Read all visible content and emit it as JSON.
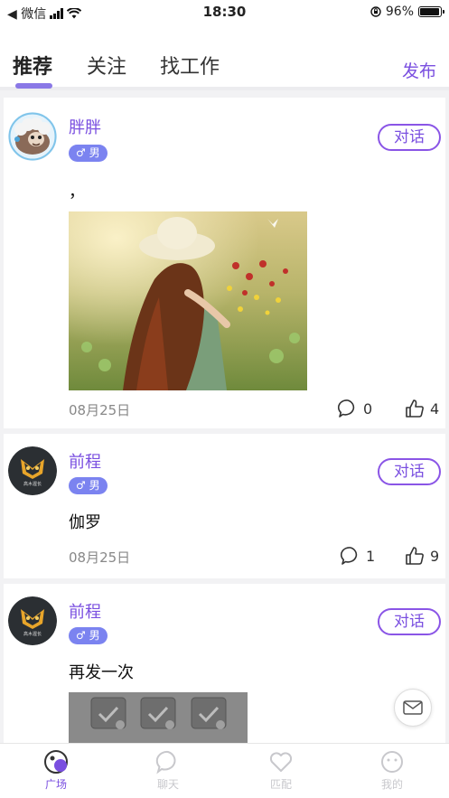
{
  "status_bar": {
    "carrier": "◀ 微信",
    "time": "18:30",
    "battery_text": "96%",
    "battery_level": 0.96
  },
  "top_tabs": [
    {
      "label": "推荐",
      "active": true
    },
    {
      "label": "关注",
      "active": false
    },
    {
      "label": "找工作",
      "active": false
    }
  ],
  "publish_label": "发布",
  "chat_label": "对话",
  "posts": [
    {
      "username": "胖胖",
      "gender": "♂ 男",
      "text": "，",
      "has_photo": true,
      "date": "08月25日",
      "comments": "0",
      "likes": "4"
    },
    {
      "username": "前程",
      "gender": "♂ 男",
      "avatar_text": "高木渥长",
      "text": "伽罗",
      "date": "08月25日",
      "comments": "1",
      "likes": "9"
    },
    {
      "username": "前程",
      "gender": "♂ 男",
      "avatar_text": "高木渥长",
      "text": "再发一次",
      "has_images": true
    }
  ],
  "bottom_tabs": [
    {
      "label": "广场",
      "icon": "plaza-icon",
      "active": true
    },
    {
      "label": "聊天",
      "icon": "chat-bubble-icon",
      "active": false
    },
    {
      "label": "匹配",
      "icon": "heart-icon",
      "active": false
    },
    {
      "label": "我的",
      "icon": "face-icon",
      "active": false
    }
  ],
  "colors": {
    "accent": "#7a4fe0",
    "tab_indicator": "#8a78e6",
    "gender_badge": "#7b83f0"
  }
}
